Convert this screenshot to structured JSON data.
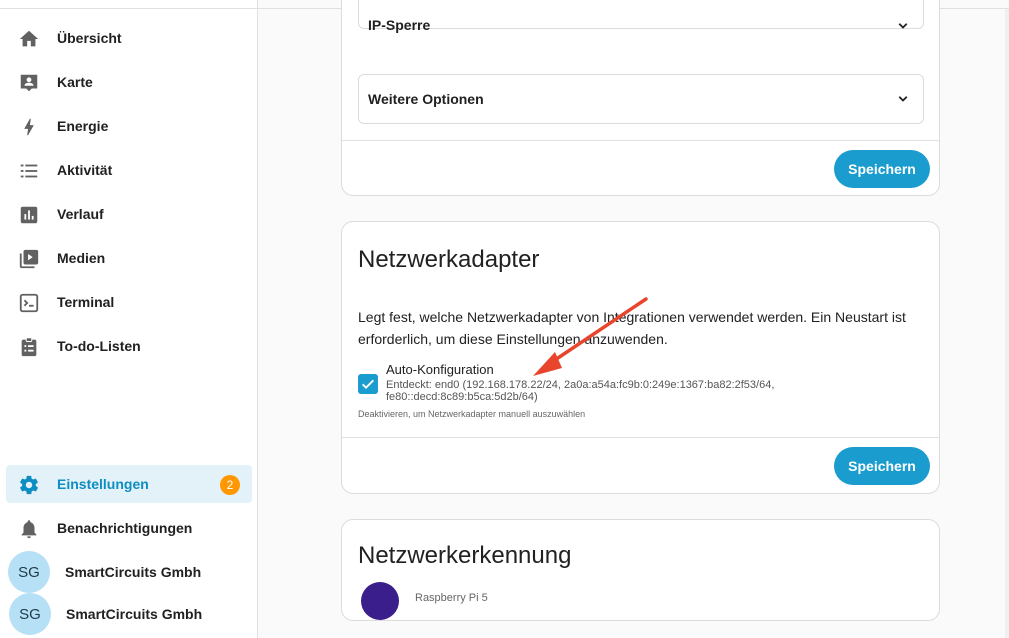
{
  "sidebar": {
    "items": [
      {
        "label": "Übersicht",
        "icon": "home-icon"
      },
      {
        "label": "Karte",
        "icon": "map-account-icon"
      },
      {
        "label": "Energie",
        "icon": "lightning-icon"
      },
      {
        "label": "Aktivität",
        "icon": "list-icon"
      },
      {
        "label": "Verlauf",
        "icon": "chart-box-icon"
      },
      {
        "label": "Medien",
        "icon": "play-box-icon"
      },
      {
        "label": "Terminal",
        "icon": "console-icon"
      },
      {
        "label": "To-do-Listen",
        "icon": "clipboard-list-icon"
      }
    ],
    "settings": {
      "label": "Einstellungen",
      "badge": "2"
    },
    "notifications": {
      "label": "Benachrichtigungen"
    },
    "users": [
      {
        "initials": "SG",
        "name": "SmartCircuits Gmbh"
      },
      {
        "initials": "SG",
        "name": "SmartCircuits Gmbh"
      }
    ]
  },
  "security_card": {
    "ip_block_label": "IP-Sperre",
    "more_options_label": "Weitere Optionen",
    "save_label": "Speichern"
  },
  "network_card": {
    "title": "Netzwerkadapter",
    "description": "Legt fest, welche Netzwerkadapter von Integrationen verwendet werden. Ein Neustart ist erforderlich, um diese Einstellungen anzuwenden.",
    "auto_config_label": "Auto-Konfiguration",
    "auto_config_checked": true,
    "detected": "Entdeckt: end0 (192.168.178.22/24, 2a0a:a54a:fc9b:0:249e:1367:ba82:2f53/64, fe80::decd:8c89:b5ca:5d2b/64)",
    "hint": "Deaktivieren, um Netzwerkadapter manuell auszuwählen",
    "save_label": "Speichern"
  },
  "hostname_card": {
    "title": "Netzwerkerkennung",
    "device_subtitle": "Raspberry Pi 5"
  },
  "colors": {
    "accent": "#1b9ccf",
    "badge": "#ff9800",
    "annotation_arrow": "#e8452c",
    "active_bg": "#e3f1f8"
  }
}
